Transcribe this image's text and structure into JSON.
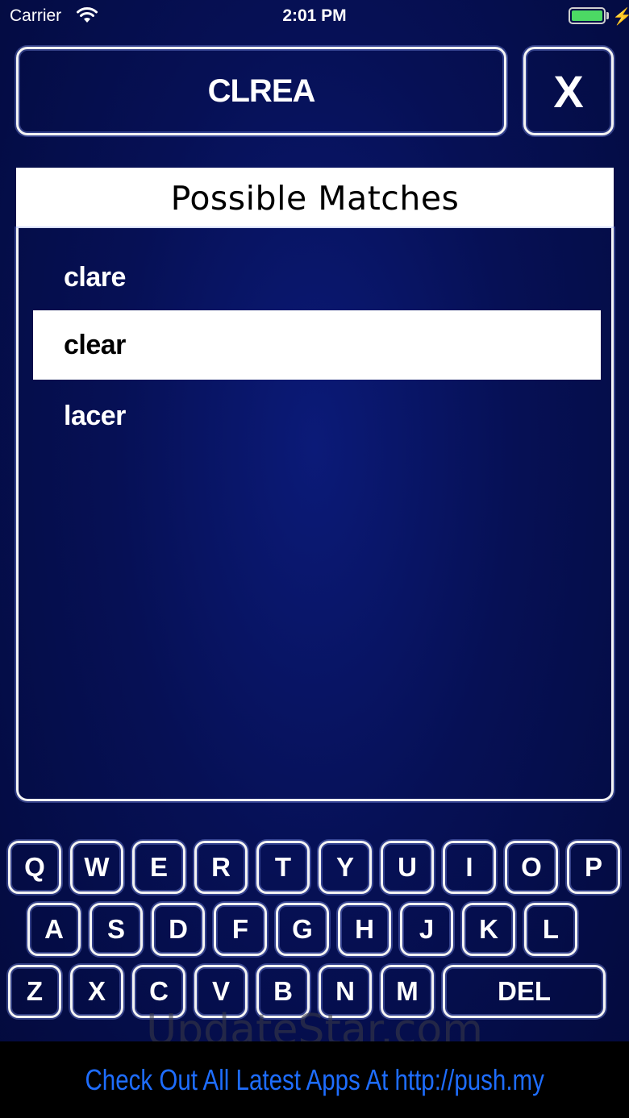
{
  "status_bar": {
    "carrier": "Carrier",
    "time": "2:01 PM",
    "battery_level": 1.0,
    "battery_color": "#4cd964",
    "charging_icon": "⚡"
  },
  "word_display": {
    "value": "CLREA"
  },
  "clear_button": {
    "label": "X"
  },
  "matches": {
    "title": "Possible Matches",
    "items": [
      {
        "label": "clare",
        "selected": false
      },
      {
        "label": "clear",
        "selected": true
      },
      {
        "label": "lacer",
        "selected": false
      }
    ]
  },
  "keyboard": {
    "row1": [
      "Q",
      "W",
      "E",
      "R",
      "T",
      "Y",
      "U",
      "I",
      "O",
      "P"
    ],
    "row2": [
      "A",
      "S",
      "D",
      "F",
      "G",
      "H",
      "J",
      "K",
      "L"
    ],
    "row3": [
      "Z",
      "X",
      "C",
      "V",
      "B",
      "N",
      "M"
    ],
    "delete_label": "DEL"
  },
  "watermark": "UpdateStar.com",
  "ad_banner": {
    "text": "Check Out All Latest Apps At http://push.my"
  },
  "colors": {
    "background": "#061055",
    "accent_link": "#1e6dff",
    "outline": "#f4f4f4"
  }
}
